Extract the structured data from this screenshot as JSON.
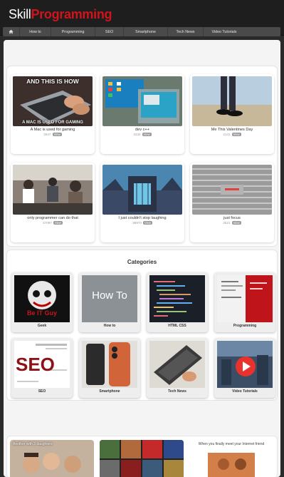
{
  "header": {
    "logo_part1": "Skill",
    "logo_part2": "Programming",
    "brand_color": "#d0141b"
  },
  "nav": {
    "home_icon": "home-icon",
    "items": [
      "How to",
      "Programming",
      "SEO",
      "Smartphone",
      "Tech News",
      "Video Tutorials"
    ]
  },
  "posts": [
    {
      "title": "A Mac is used for gaming",
      "views": "2547",
      "badge": "View",
      "caption_top": "AND THIS IS HOW",
      "caption_bottom": "A MAC IS USED FOR GAMING"
    },
    {
      "title": "dev c++",
      "views": "2232",
      "badge": "View"
    },
    {
      "title": "Me This Valentines Day",
      "views": "2141",
      "badge": "View"
    },
    {
      "title": "only programmer can do that",
      "views": "27097",
      "badge": "View"
    },
    {
      "title": "I just couldn't stop laughing",
      "views": "38970",
      "badge": "View"
    },
    {
      "title": "just focus",
      "views": "2621",
      "badge": "View"
    }
  ],
  "categories_title": "Categories",
  "categories": [
    {
      "label": "Geek",
      "image_text": "Be IT Guy"
    },
    {
      "label": "How to",
      "image_text": "How To"
    },
    {
      "label": "HTML CSS"
    },
    {
      "label": "Programming"
    },
    {
      "label": "SEO",
      "image_text": "SEO"
    },
    {
      "label": "Smartphone"
    },
    {
      "label": "Tech News"
    },
    {
      "label": "Video Tutorials"
    }
  ],
  "bottom_posts": [
    {
      "image_text": "Another with 3 daughters"
    },
    {},
    {
      "image_text": "When you finally meet your Internet friend"
    }
  ]
}
